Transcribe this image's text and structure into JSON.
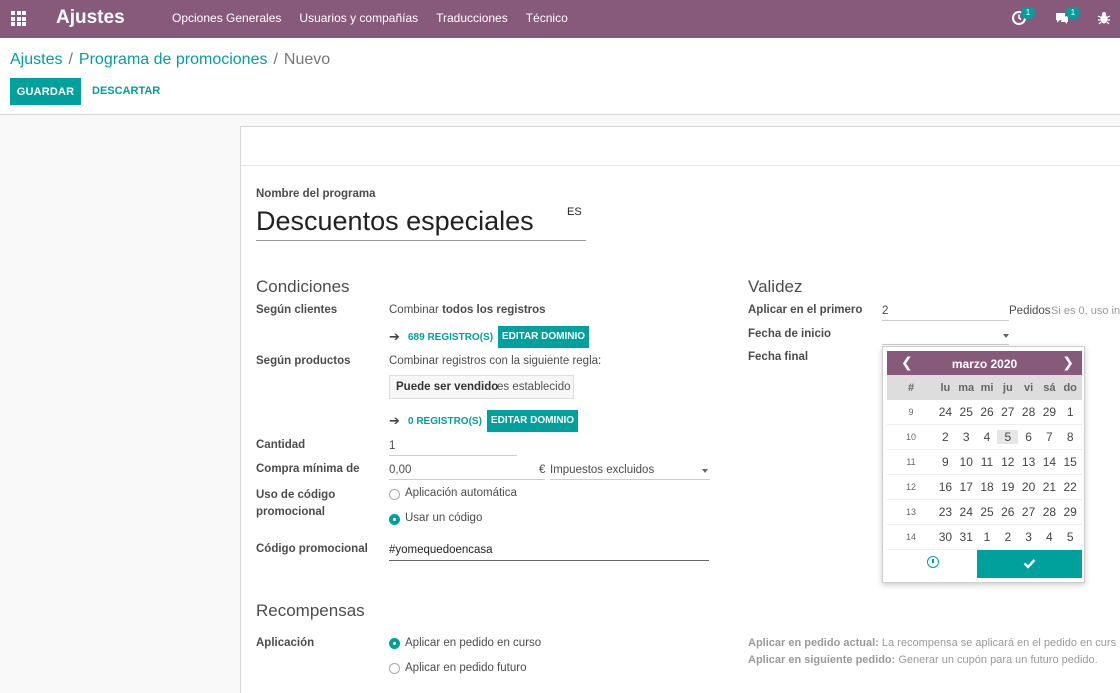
{
  "navbar": {
    "app_title": "Ajustes",
    "menu": [
      "Opciones Generales",
      "Usuarios y compañías",
      "Traducciones",
      "Técnico"
    ],
    "activity_badge": "1",
    "messages_badge": "1",
    "colors": {
      "brand": "#875a7b",
      "accent": "#00a09d"
    }
  },
  "breadcrumb": {
    "root": "Ajustes",
    "parent": "Programa de promociones",
    "current": "Nuevo",
    "separator": "/"
  },
  "actions": {
    "save": "GUARDAR",
    "discard": "DESCARTAR"
  },
  "form": {
    "name_label": "Nombre del programa",
    "name_value": "Descuentos especiales",
    "lang": "ES",
    "conditions": {
      "title": "Condiciones",
      "customers_label": "Según clientes",
      "customers_text_prefix": "Combinar",
      "customers_text_bold": "todos los registros",
      "customers_records": "689 REGISTRO(S)",
      "edit_domain": "EDITAR DOMINIO",
      "products_label": "Según productos",
      "products_text": "Combinar registros con la siguiente regla:",
      "rule_field": "Puede ser vendido",
      "rule_operator": "es establecido",
      "products_records": "0 REGISTRO(S)",
      "quantity_label": "Cantidad",
      "quantity_value": "1",
      "min_purchase_label": "Compra mínima de",
      "min_purchase_value": "0,00",
      "currency": "€",
      "taxes_value": "Impuestos excluidos",
      "promo_code_usage_label": "Uso de código promocional",
      "promo_option_auto": "Aplicación automática",
      "promo_option_code": "Usar un código",
      "promo_code_label": "Código promocional",
      "promo_code_value": "#yomequedoencasa"
    },
    "validity": {
      "title": "Validez",
      "apply_first_label": "Aplicar en el primero",
      "apply_first_value": "2",
      "apply_first_unit": "Pedidos",
      "apply_first_help": "Si es 0, uso in",
      "start_date_label": "Fecha de inicio",
      "end_date_label": "Fecha final"
    },
    "rewards": {
      "title": "Recompensas",
      "application_label": "Aplicación",
      "option_current": "Aplicar en pedido en curso",
      "option_future": "Aplicar en pedido futuro",
      "help_current_bold": "Aplicar en pedido actual:",
      "help_current_text": "La recompensa se aplicará en el pedido en curs",
      "help_future_bold": "Aplicar en siguiente pedido:",
      "help_future_text": "Generar un cupón para un futuro pedido."
    }
  },
  "datepicker": {
    "month": "marzo 2020",
    "headers": [
      "#",
      "lu",
      "ma",
      "mi",
      "ju",
      "vi",
      "sá",
      "do"
    ],
    "today": "5",
    "weeks": [
      {
        "num": "9",
        "days": [
          "24",
          "25",
          "26",
          "27",
          "28",
          "29",
          "1"
        ]
      },
      {
        "num": "10",
        "days": [
          "2",
          "3",
          "4",
          "5",
          "6",
          "7",
          "8"
        ]
      },
      {
        "num": "11",
        "days": [
          "9",
          "10",
          "11",
          "12",
          "13",
          "14",
          "15"
        ]
      },
      {
        "num": "12",
        "days": [
          "16",
          "17",
          "18",
          "19",
          "20",
          "21",
          "22"
        ]
      },
      {
        "num": "13",
        "days": [
          "23",
          "24",
          "25",
          "26",
          "27",
          "28",
          "29"
        ]
      },
      {
        "num": "14",
        "days": [
          "30",
          "31",
          "1",
          "2",
          "3",
          "4",
          "5"
        ]
      }
    ]
  }
}
